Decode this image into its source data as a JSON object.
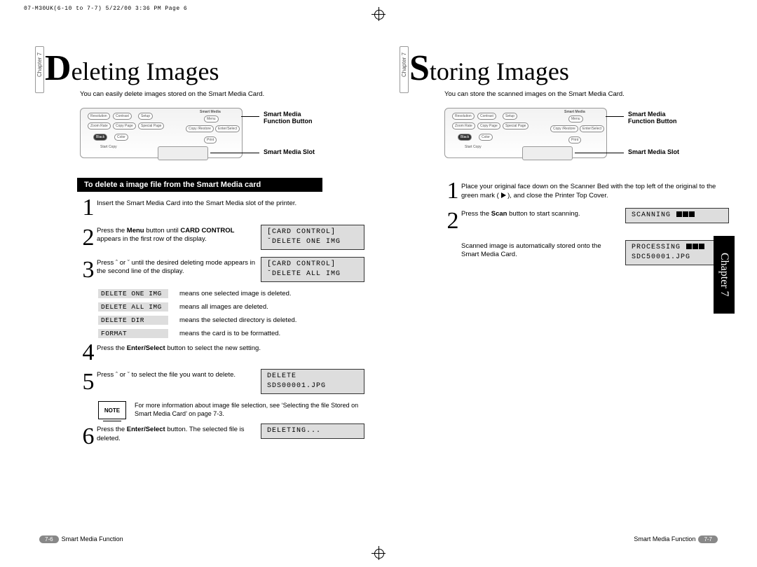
{
  "header_line": "07-M30UK(6-10 to 7-7)  5/22/00 3:36 PM  Page 6",
  "chapter_tab": "Chapter 7",
  "left": {
    "title_big": "D",
    "title_rest": "eleting Images",
    "intro": "You can easily delete images stored on the Smart Media Card.",
    "callout_button": "Smart Media\nFunction Button",
    "callout_slot": "Smart Media Slot",
    "section_head": "To delete a image file from the Smart Media card",
    "steps": {
      "1": "Insert the Smart Media Card into the Smart Media slot of the printer.",
      "2": "Press the Menu button until CARD CONTROL appears in the first row of the display.",
      "3": "Press ˆ or ˇ until the desired deleting mode appears in the second line of the display.",
      "4": "Press the Enter/Select button to select the new setting.",
      "5": "Press ˆ or ˇ to select the file you want to delete.",
      "6": "Press the Enter/Select button. The selected file is deleted."
    },
    "lcd": {
      "2a": "[CARD CONTROL]",
      "2b": "ˇDELETE ONE IMG",
      "3a": "[CARD CONTROL]",
      "3b": "ˇDELETE ALL IMG",
      "5a": "DELETE",
      "5b": "SDS00001.JPG",
      "6a": "DELETING..."
    },
    "defs": {
      "DELETE ONE IMG": "means one selected image is deleted.",
      "DELETE ALL IMG": "means all images are deleted.",
      "DELETE DIR": "means the selected directory is deleted.",
      "FORMAT": "means the card is to be formatted."
    },
    "note_label": "NOTE",
    "note_text": "For more information about image file selection, see ‘Selecting the file Stored on Smart Media Card’ on page 7-3.",
    "footer_page": "7-6",
    "footer_text": "Smart Media Function"
  },
  "right": {
    "title_big": "S",
    "title_rest": "toring Images",
    "intro": "You can store the scanned images on the Smart Media Card.",
    "callout_button": "Smart Media\nFunction Button",
    "callout_slot": "Smart Media Slot",
    "steps": {
      "1": "Place your original face down on the Scanner Bed with the top left of the original to the green mark ( ▶ ), and close the Printer Top Cover.",
      "2a": "Press the Scan button to start scanning.",
      "2b": "Scanned image is automatically stored onto the Smart Media Card."
    },
    "lcd": {
      "2a": "SCANNING ███",
      "2b1": "PROCESSING ███",
      "2b2": "SDC50001.JPG"
    },
    "side_tab": "Chapter 7",
    "footer_text": "Smart Media Function",
    "footer_page": "7-7"
  },
  "panel": {
    "btns": {
      "r1": [
        "Resolution",
        "Contrast",
        "Setup"
      ],
      "r2": [
        "Zoom Rate",
        "Copy Page",
        "Special Page"
      ],
      "r3": [
        "Black",
        "Color"
      ],
      "start": "Start Copy",
      "sm_menu": "Menu",
      "sm_mode": "Copy /Restore",
      "sm_es": "Enter/Select",
      "sm_print": "Print",
      "sm_label": "Smart Media"
    }
  }
}
